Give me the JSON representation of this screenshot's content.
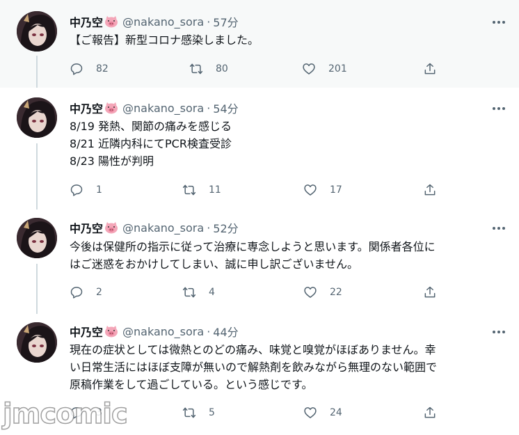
{
  "tweets": [
    {
      "name": "中乃空",
      "handle": "@nakano_sora",
      "separator": "·",
      "time": "57分",
      "text": "【ご報告】新型コロナ感染しました。",
      "replies": "82",
      "retweets": "80",
      "likes": "201"
    },
    {
      "name": "中乃空",
      "handle": "@nakano_sora",
      "separator": "·",
      "time": "54分",
      "text": "8/19 発熱、関節の痛みを感じる\n8/21 近隣内科にてPCR検査受診\n8/23 陽性が判明",
      "replies": "1",
      "retweets": "11",
      "likes": "17"
    },
    {
      "name": "中乃空",
      "handle": "@nakano_sora",
      "separator": "·",
      "time": "52分",
      "text": "今後は保健所の指示に従って治療に専念しようと思います。関係者各位に\nはご迷惑をおかけしてしまい、誠に申し訳ございません。",
      "replies": "2",
      "retweets": "4",
      "likes": "22"
    },
    {
      "name": "中乃空",
      "handle": "@nakano_sora",
      "separator": "·",
      "time": "44分",
      "text": "現在の症状としては微熱とのどの痛み、味覚と嗅覚がほぼありません。幸\nい日常生活にはほぼ支障が無いので解熱剤を飲みながら無理のない範囲で\n原稿作業をして過ごしている。という感じです。",
      "replies": "3",
      "retweets": "5",
      "likes": "24"
    }
  ],
  "icons": {
    "reply": "reply-icon",
    "retweet": "retweet-icon",
    "like": "heart-icon",
    "share": "share-icon",
    "more": "more-icon",
    "pig": "pig-emoji-icon"
  },
  "colors": {
    "text_primary": "#0f1419",
    "text_secondary": "#536471",
    "divider": "#e6ecf0",
    "thread_line": "#cfd9de",
    "pig_pink": "#f4a6b8"
  },
  "watermark": "jmcomic"
}
